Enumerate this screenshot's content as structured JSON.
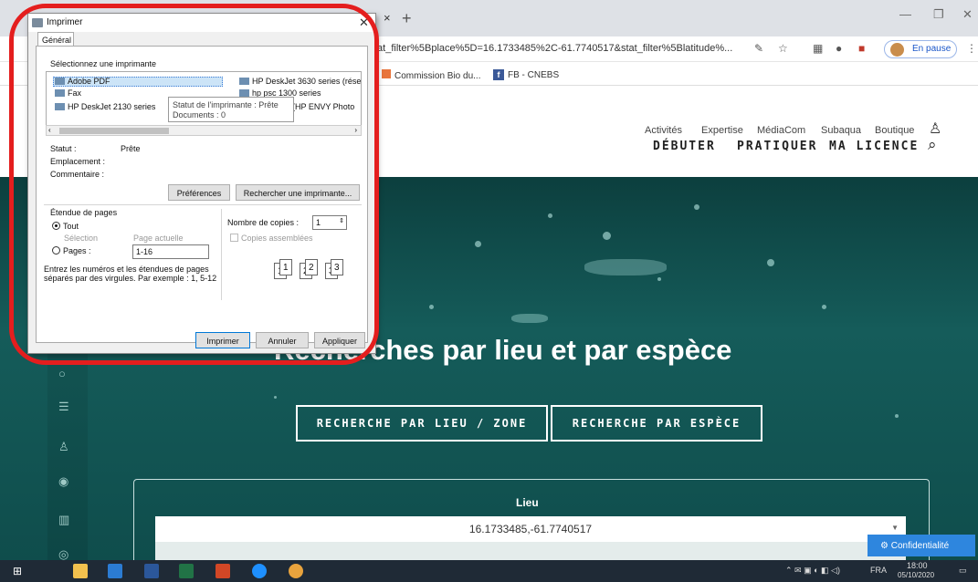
{
  "browser": {
    "tab_close": "×",
    "new_tab": "+",
    "url": "tat_filter%5Bplace%5D=16.1733485%2C-61.7740517&stat_filter%5Blatitude%...",
    "profile": "En pause",
    "win": {
      "min": "—",
      "max": "❐",
      "close": "✕"
    },
    "bookmarks": [
      "Commission Bio du...",
      "FB - CNEBS"
    ]
  },
  "site": {
    "top_nav": [
      "Activités",
      "Expertise",
      "MédiaCom",
      "Subaqua",
      "Boutique"
    ],
    "main_nav": [
      "DÉBUTER",
      "PRATIQUER",
      "MA LICENCE"
    ],
    "hero_title": "Recherches par lieu et par espèce",
    "btn_lieu": "RECHERCHE PAR LIEU / ZONE",
    "btn_espece": "RECHERCHE PAR ESPÈCE",
    "lieu_label": "Lieu",
    "lieu_value": "16.1733485,-61.7740517",
    "confidentialite": "Confidentialité"
  },
  "dialog": {
    "title": "Imprimer",
    "tab": "Général",
    "select_printer": "Sélectionnez une imprimante",
    "printers": [
      "Adobe PDF",
      "HP DeskJet 3630 series (rése",
      "Fax",
      "hp psc 1300 series",
      "HP DeskJet 2130 series",
      "(HP ENVY Photo"
    ],
    "tooltip": [
      "Statut de l'imprimante : Prête",
      "Documents : 0"
    ],
    "status_label": "Statut :",
    "status_value": "Prête",
    "location_label": "Emplacement :",
    "comment_label": "Commentaire :",
    "btn_prefs": "Préférences",
    "btn_find": "Rechercher une imprimante...",
    "range_title": "Étendue de pages",
    "range_all": "Tout",
    "range_selection": "Sélection",
    "range_current": "Page actuelle",
    "range_pages": "Pages :",
    "range_pages_value": "1-16",
    "range_hint": "Entrez les numéros et les étendues de pages séparés par des virgules. Par exemple : 1, 5-12",
    "copies_label": "Nombre de copies :",
    "copies_value": "1",
    "collate": "Copies assemblées",
    "btn_print": "Imprimer",
    "btn_cancel": "Annuler",
    "btn_apply": "Appliquer"
  },
  "taskbar": {
    "lang": "FRA",
    "time": "18:00",
    "date": "05/10/2020"
  },
  "colors": {
    "highlight": "#e41e1e",
    "hero": "#155c5a",
    "accent": "#2e86de"
  }
}
